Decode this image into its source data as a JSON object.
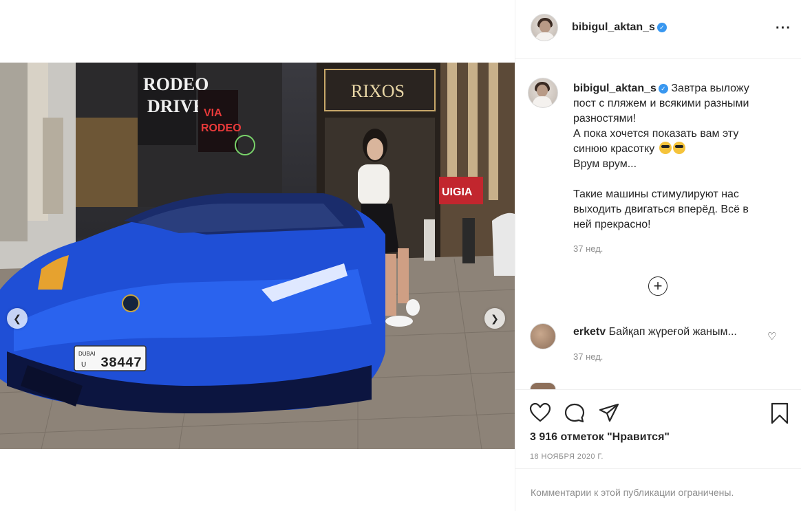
{
  "post": {
    "username": "bibigul_aktan_s",
    "caption_lines": [
      "Завтра выложу",
      "пост с пляжем и всякими разными",
      "разностями!",
      "А пока хочется показать вам эту",
      "синюю красотку",
      "Врум врум...",
      "",
      "Такие машины стимулируют нас",
      "выходить двигаться вперёд. Всё в",
      "ней прекрасно!"
    ],
    "caption_time": "37 нед.",
    "likes_text": "3 916 отметок \"Нравится\"",
    "date": "18 НОЯБРЯ 2020 Г.",
    "comments_disabled": "Комментарии к этой публикации ограничены."
  },
  "photo": {
    "sign_rodeo_drive": "RODEO DRIVE",
    "sign_via_rodeo": "VIA RODEO",
    "sign_rixos": "RIXOS",
    "sign_uigia": "UIGIA",
    "plate_emirate": "DUBAI",
    "plate_letter": "U",
    "plate_number": "38447"
  },
  "comments": [
    {
      "username": "erketv",
      "text": "Байқап жүреғой жаным...",
      "time": "37 нед."
    }
  ],
  "icons": {
    "more": "more-icon",
    "like": "heart-icon",
    "comment": "comment-icon",
    "share": "share-icon",
    "save": "bookmark-icon",
    "prev": "chevron-left-icon",
    "next": "chevron-right-icon",
    "load_more": "plus-circle-icon"
  },
  "colors": {
    "car": "#1f4fd6",
    "verified": "#3897f0",
    "muted": "#8e8e8e"
  }
}
